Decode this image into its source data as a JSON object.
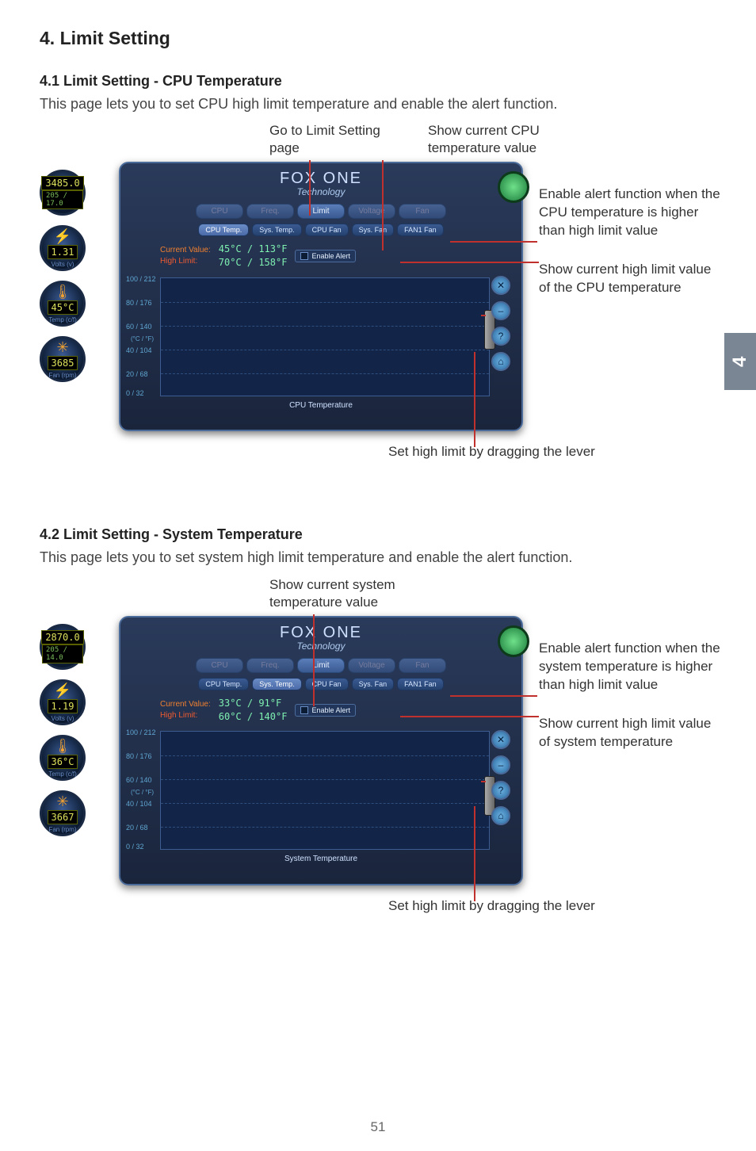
{
  "page": {
    "title": "4. Limit Setting",
    "number": "51",
    "tab": "4"
  },
  "section41": {
    "heading": "4.1 Limit Setting - CPU Temperature",
    "desc": "This page lets you to set CPU high limit temperature and enable the alert function.",
    "topLabel1": "Go to Limit Setting page",
    "topLabel2": "Show current CPU temperature value",
    "rightNote1": "Enable alert function when the CPU temperature is higher than high limit value",
    "rightNote2": "Show current high limit value of the CPU temperature",
    "bottomNote": "Set high limit by dragging the lever",
    "panel": {
      "brand": "FOX ONE",
      "brandSub": "Technology",
      "tabs": [
        "CPU",
        "Freq.",
        "Limit",
        "Voltage",
        "Fan"
      ],
      "subtabs": [
        "CPU Temp.",
        "Sys. Temp.",
        "CPU Fan",
        "Sys. Fan",
        "FAN1 Fan"
      ],
      "activeSubtab": 0,
      "currentLabel": "Current Value:",
      "highLimitLabel": "High Limit:",
      "currentValue": "45°C / 113°F",
      "highLimit": "70°C / 158°F",
      "enableAlert": "Enable Alert",
      "chartCaption": "CPU Temperature",
      "yTicks": [
        "100 / 212",
        "80 / 176",
        "60 / 140",
        "40 / 104",
        "20 / 68",
        "0 / 32"
      ],
      "axisUnit": "(°C / °F)",
      "leftGauges": {
        "freqTop": "3485.0",
        "freqBottom": "205 / 17.0",
        "volts": "1.31",
        "voltsSub": "Volts (v)",
        "temp": "45°C",
        "tempSub": "Temp (c/f)",
        "rpm": "3685",
        "rpmSub": "Fan (rpm)"
      }
    }
  },
  "section42": {
    "heading": "4.2 Limit Setting - System Temperature",
    "desc": "This page lets you to set system high limit temperature and enable the alert function.",
    "topLabel": "Show current system temperature value",
    "rightNote1": "Enable alert function when the system temperature is higher than high limit value",
    "rightNote2": "Show current high limit value of system temperature",
    "bottomNote": "Set high limit by dragging the lever",
    "panel": {
      "brand": "FOX ONE",
      "brandSub": "Technology",
      "tabs": [
        "CPU",
        "Freq.",
        "Limit",
        "Voltage",
        "Fan"
      ],
      "subtabs": [
        "CPU Temp.",
        "Sys. Temp.",
        "CPU Fan",
        "Sys. Fan",
        "FAN1 Fan"
      ],
      "activeSubtab": 1,
      "currentLabel": "Current Value:",
      "highLimitLabel": "High Limit:",
      "currentValue": "33°C / 91°F",
      "highLimit": "60°C / 140°F",
      "enableAlert": "Enable Alert",
      "chartCaption": "System Temperature",
      "yTicks": [
        "100 / 212",
        "80 / 176",
        "60 / 140",
        "40 / 104",
        "20 / 68",
        "0 / 32"
      ],
      "axisUnit": "(°C / °F)",
      "leftGauges": {
        "freqTop": "2870.0",
        "freqBottom": "205 / 14.0",
        "volts": "1.19",
        "voltsSub": "Volts (v)",
        "temp": "36°C",
        "tempSub": "Temp (c/f)",
        "rpm": "3667",
        "rpmSub": "Fan (rpm)"
      }
    }
  }
}
